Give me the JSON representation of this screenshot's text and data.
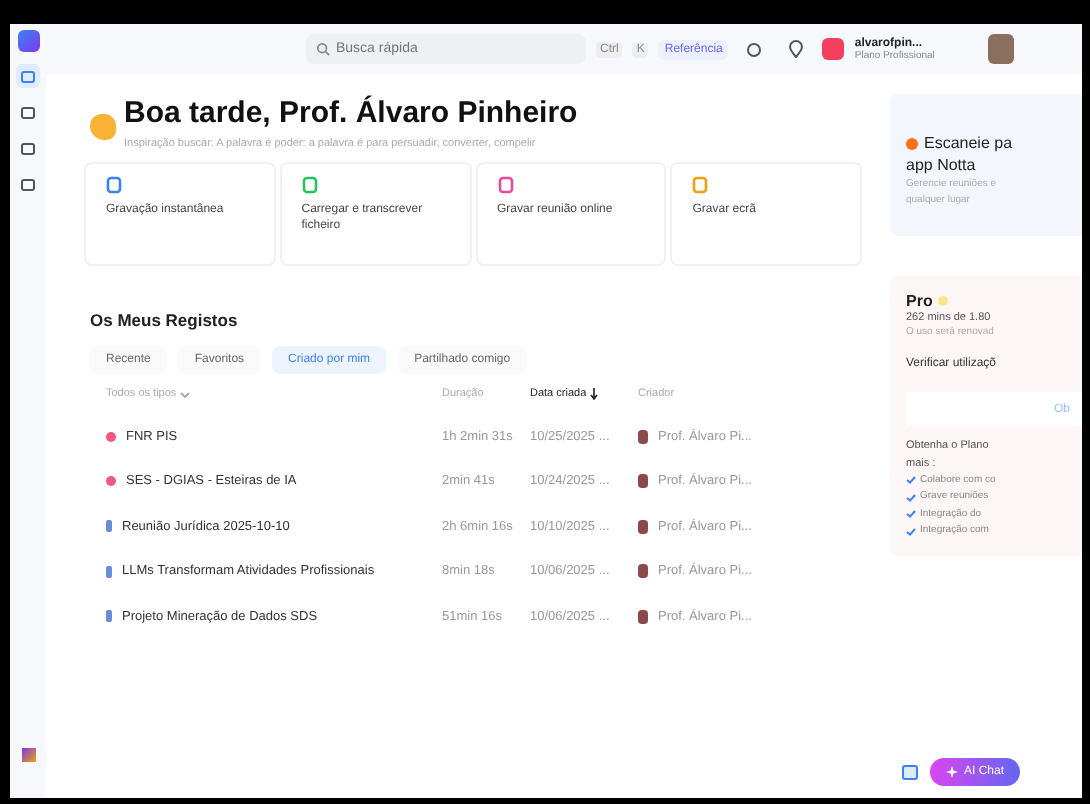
{
  "topbar": {
    "search": {
      "placeholder": "Busca rápida"
    },
    "shortcut": [
      "Ctrl",
      "K"
    ],
    "reference": "Referência",
    "user": {
      "name": "alvarofpin...",
      "plan": "Plano Profissional"
    }
  },
  "sidebar": {
    "items": [
      {
        "selected": true
      },
      {
        "selected": false
      },
      {
        "selected": false
      },
      {
        "selected": false
      }
    ]
  },
  "greeting": {
    "title": "Boa tarde, Prof. Álvaro Pinheiro",
    "quote": "Inspiração buscar: A palavra é poder: a palavra é para persuadir, converter, compelir"
  },
  "actions": [
    {
      "label": "Gravação instantânea",
      "color": "#3b82f6"
    },
    {
      "label": "Carregar e transcrever ficheiro",
      "color": "#22c55e"
    },
    {
      "label": "Gravar reunião online",
      "color": "#ec4899"
    },
    {
      "label": "Gravar ecrã",
      "color": "#f59e0b"
    }
  ],
  "records": {
    "title": "Os Meus Registos",
    "tabs": [
      {
        "label": "Recente",
        "selected": false
      },
      {
        "label": "Favoritos",
        "selected": false
      },
      {
        "label": "Criado por mim",
        "selected": true
      },
      {
        "label": "Partilhado comigo",
        "selected": false
      }
    ],
    "columns": [
      "Todos os tipos",
      "Duração",
      "Data criada",
      "Criador"
    ],
    "rows": [
      {
        "kind": "meeting",
        "name": "FNR PIS",
        "duration": "1h 2min 31s",
        "date": "10/25/2025 ...",
        "creator": "Prof. Álvaro Pi..."
      },
      {
        "kind": "meeting",
        "name": "SES - DGIAS - Esteiras de IA",
        "duration": "2min 41s",
        "date": "10/24/2025 ...",
        "creator": "Prof. Álvaro Pi..."
      },
      {
        "kind": "file",
        "name": "Reunião Jurídica 2025-10-10",
        "duration": "2h 6min 16s",
        "date": "10/10/2025 ...",
        "creator": "Prof. Álvaro Pi..."
      },
      {
        "kind": "file",
        "name": "LLMs Transformam Atividades Profissionais",
        "duration": "8min 18s",
        "date": "10/06/2025 ...",
        "creator": "Prof. Álvaro Pi..."
      },
      {
        "kind": "file",
        "name": "Projeto Mineração de Dados SDS",
        "duration": "51min 16s",
        "date": "10/06/2025 ...",
        "creator": "Prof. Álvaro Pi..."
      }
    ]
  },
  "promo": {
    "title": "Escaneie pa",
    "title2": "app Notta",
    "text": "Gerencie reuniões e",
    "text2": "qualquer lugar"
  },
  "plan": {
    "title": "Pro",
    "usage": "262 mins de 1.80",
    "renew": "O uso será renovad",
    "check": "Verificar utilizaçõ",
    "button": "Ob",
    "offer": "Obtenha o Plano",
    "offer2": "mais :",
    "features": [
      "Colabore com co",
      "Grave reuniões",
      "Integração do",
      "Integração com"
    ]
  },
  "ai_chat": "AI Chat"
}
